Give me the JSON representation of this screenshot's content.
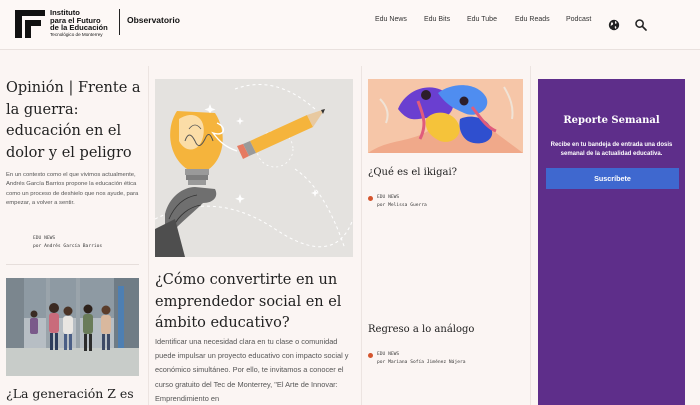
{
  "header": {
    "logo_lines": [
      "Instituto",
      "para el Futuro",
      "de la Educación"
    ],
    "logo_sub": "Tecnológico de Monterrey",
    "section": "Observatorio",
    "nav": [
      "Edu News",
      "Edu Bits",
      "Edu Tube",
      "Edu Reads",
      "Podcast"
    ],
    "icons": [
      "globe-icon",
      "search-icon"
    ]
  },
  "col1": {
    "article1": {
      "title": "Opinión | Frente a la guerra: educación en el dolor y el peligro",
      "excerpt": "En un contexto como el que vivimos actualmente, Andrés García Barrios propone la educación ética como un proceso de deshielo que nos ayude, para empezar, a volver a sentir.",
      "category": "EDU NEWS",
      "byline": "por Andrés García Barrios"
    },
    "article2": {
      "title": "¿La generación Z es más sana?"
    }
  },
  "col2": {
    "title": "¿Cómo convertirte en un emprendedor social en el ámbito educativo?",
    "excerpt": "Identificar una necesidad clara en tu clase o comunidad puede impulsar un proyecto educativo con impacto social y económico simultáneo. Por ello, te invitamos a conocer el curso gratuito del Tec de Monterrey, \"El Arte de Innovar: Emprendimiento en"
  },
  "col3": {
    "article1": {
      "title": "¿Qué es el ikigai?",
      "category": "EDU NEWS",
      "byline": "por Melissa Guerra"
    },
    "article2": {
      "title": "Regreso a lo análogo",
      "category": "EDU NEWS",
      "byline": "por Mariana Sofía Jiménez Nájera"
    }
  },
  "newsletter": {
    "title": "Reporte Semanal",
    "text": "Recibe en tu bandeja de entrada una dosis semanal de la actualidad educativa.",
    "button": "Suscríbete"
  },
  "colors": {
    "background": "#fbf5f3",
    "accent_purple": "#5e2e8a",
    "button_blue": "#3f68cf",
    "category_dot": "#d4552e",
    "pencil_yellow": "#f5b43c"
  }
}
